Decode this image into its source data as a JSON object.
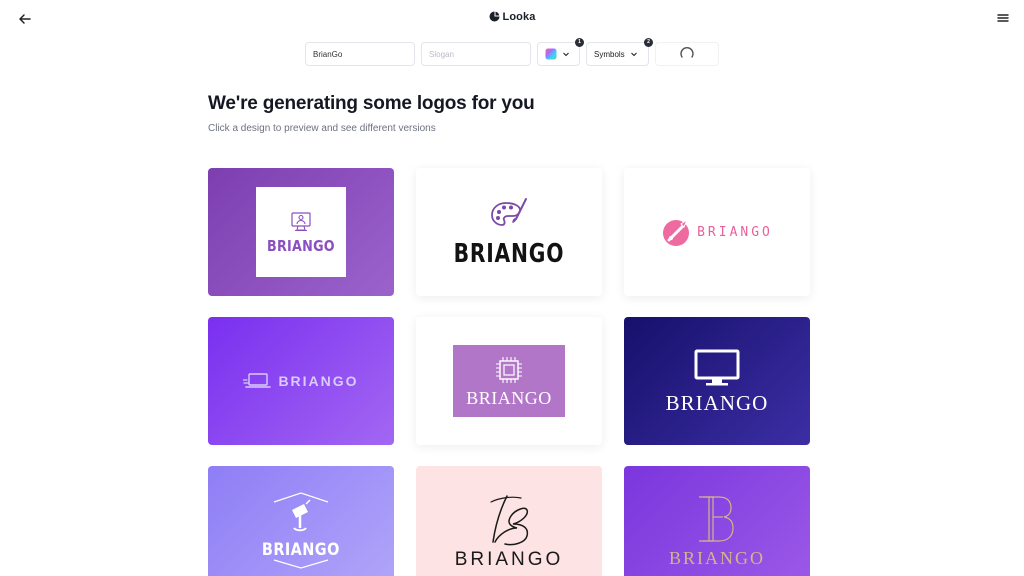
{
  "header": {
    "brand": "Looka",
    "back_icon": "arrow-left-icon",
    "menu_icon": "hamburger-menu-icon"
  },
  "toolbar": {
    "company_name_value": "BrianGo",
    "slogan_placeholder": "Slogan",
    "colors_badge": "1",
    "symbols_label": "Symbols",
    "symbols_badge": "2"
  },
  "main": {
    "title": "We're generating some logos for you",
    "subtitle": "Click a design to preview and see different versions"
  },
  "logos": [
    {
      "text": "BRIANGO",
      "icon": "computer-user-icon",
      "background": "#8a4fc0",
      "text_color": "#8a4fc0"
    },
    {
      "text": "BRIANGO",
      "icon": "paint-palette-icon",
      "background": "#ffffff",
      "text_color": "#121212"
    },
    {
      "text": "BRIANGO",
      "icon": "pink-circle-brush-icon",
      "background": "#ffffff",
      "text_color": "#e8619a"
    },
    {
      "text": "BRIANGO",
      "icon": "laptop-icon",
      "background": "#8a4ff1",
      "text_color": "#d9cbff"
    },
    {
      "text": "BRIANGO",
      "icon": "microchip-icon",
      "background": "#b276c9",
      "text_color": "#ffffff"
    },
    {
      "text": "BRIANGO",
      "icon": "monitor-icon",
      "background": "#22198a",
      "text_color": "#ffffff"
    },
    {
      "text": "BRIANGO",
      "icon": "hexagon-paintbrush-icon",
      "background": "#9f92f7",
      "text_color": "#ffffff"
    },
    {
      "text": "BRIANGO",
      "icon": "script-b-monogram-icon",
      "background": "#fde3e3",
      "text_color": "#1a1a1a"
    },
    {
      "text": "BRIANGO",
      "icon": "serif-b-monogram-icon",
      "background": "#8c48e3",
      "text_color": "#d2b58a"
    }
  ]
}
